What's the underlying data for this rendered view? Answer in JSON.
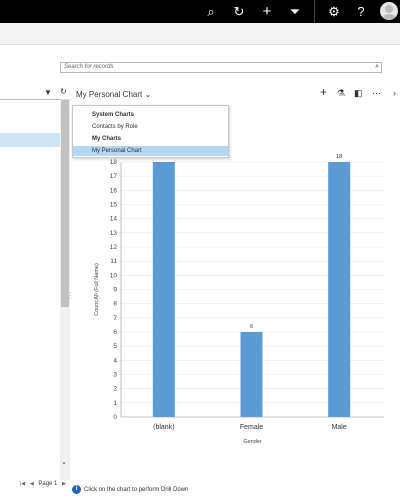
{
  "top_bar": {
    "icons": [
      "search-icon",
      "history-icon",
      "plus-icon",
      "filter-icon",
      "gear-icon",
      "help-icon",
      "avatar"
    ]
  },
  "search": {
    "placeholder": "Search for records"
  },
  "chart_header": {
    "title": "My Personal Chart",
    "chevron": "⌄"
  },
  "chart_menu": {
    "group1": "System Charts",
    "item1": "Contacts by Role",
    "group2": "My Charts",
    "item2": "My Personal Chart"
  },
  "footer": {
    "hint": "Click on the chart to perform Drill Down"
  },
  "pager": {
    "label": "Page 1"
  },
  "chart_data": {
    "type": "bar",
    "categories": [
      "(blank)",
      "Female",
      "Male"
    ],
    "values": [
      18,
      6,
      18
    ],
    "data_labels": [
      "",
      "6",
      "18"
    ],
    "ylabel": "Count:All (Full Name)",
    "xlabel": "Gender",
    "ylim": [
      0,
      18
    ],
    "yticks": [
      "0",
      "1",
      "2",
      "3",
      "4",
      "5",
      "6",
      "7",
      "8",
      "9",
      "10",
      "11",
      "12",
      "13",
      "14",
      "15",
      "16",
      "17",
      "18"
    ],
    "bar_color": "#5b9bd5",
    "grid": true
  }
}
